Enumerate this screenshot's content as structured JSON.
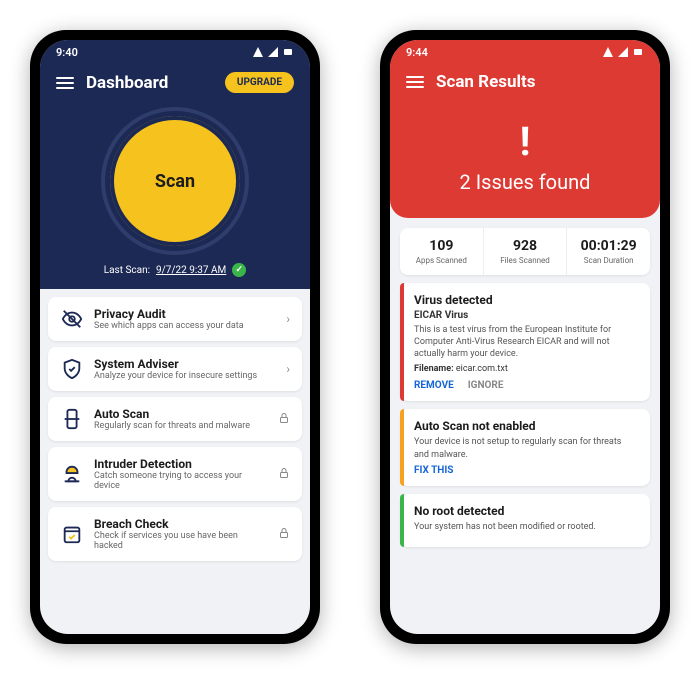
{
  "phone1": {
    "time": "9:40",
    "title": "Dashboard",
    "upgrade": "UPGRADE",
    "scan_label": "Scan",
    "last_scan_prefix": "Last Scan:",
    "last_scan_time": "9/7/22 9:37 AM",
    "features": [
      {
        "title": "Privacy Audit",
        "sub": "See which apps can access your data",
        "trail": "chevron"
      },
      {
        "title": "System Adviser",
        "sub": "Analyze your device for insecure settings",
        "trail": "chevron"
      },
      {
        "title": "Auto Scan",
        "sub": "Regularly scan for threats and malware",
        "trail": "lock"
      },
      {
        "title": "Intruder Detection",
        "sub": "Catch someone trying to access your device",
        "trail": "lock"
      },
      {
        "title": "Breach Check",
        "sub": "Check if services you use have been hacked",
        "trail": "lock"
      }
    ]
  },
  "phone2": {
    "time": "9:44",
    "title": "Scan Results",
    "issues_text": "2 Issues found",
    "stats": [
      {
        "num": "109",
        "label": "Apps Scanned"
      },
      {
        "num": "928",
        "label": "Files Scanned"
      },
      {
        "num": "00:01:29",
        "label": "Scan Duration"
      }
    ],
    "results": {
      "virus": {
        "title": "Virus detected",
        "name": "EICAR Virus",
        "desc": "This is a test virus from the European Institute for Computer Anti-Virus Research EICAR and will not actually harm your device.",
        "filename_label": "Filename:",
        "filename": "eicar.com.txt",
        "remove": "REMOVE",
        "ignore": "IGNORE"
      },
      "autoscan": {
        "title": "Auto Scan not enabled",
        "desc": "Your device is not setup to regularly scan for threats and malware.",
        "fix": "FIX THIS"
      },
      "root": {
        "title": "No root detected",
        "desc": "Your system has not been modified or rooted."
      }
    }
  }
}
